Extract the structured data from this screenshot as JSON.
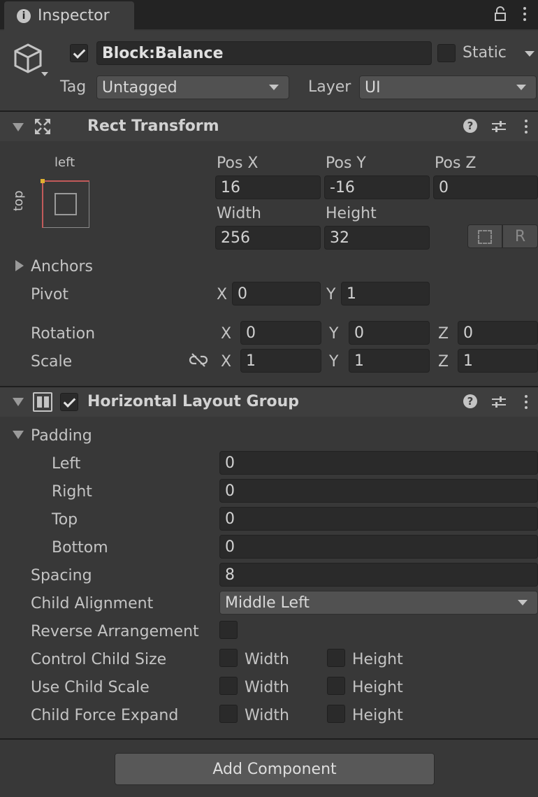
{
  "tab": {
    "title": "Inspector"
  },
  "object": {
    "name": "Block:Balance",
    "active": true,
    "static_label": "Static",
    "static_checked": false,
    "tag_label": "Tag",
    "tag_value": "Untagged",
    "layer_label": "Layer",
    "layer_value": "UI"
  },
  "rect_transform": {
    "title": "Rect Transform",
    "anchor_preset": {
      "horizontal": "left",
      "vertical": "top"
    },
    "pos_x_label": "Pos X",
    "pos_y_label": "Pos Y",
    "pos_z_label": "Pos Z",
    "pos_x": "16",
    "pos_y": "-16",
    "pos_z": "0",
    "width_label": "Width",
    "height_label": "Height",
    "width": "256",
    "height": "32",
    "raw_button": "R",
    "anchors_label": "Anchors",
    "pivot_label": "Pivot",
    "pivot": {
      "x_label": "X",
      "x": "0",
      "y_label": "Y",
      "y": "1"
    },
    "rotation_label": "Rotation",
    "rotation": {
      "x_label": "X",
      "x": "0",
      "y_label": "Y",
      "y": "0",
      "z_label": "Z",
      "z": "0"
    },
    "scale_label": "Scale",
    "scale": {
      "x_label": "X",
      "x": "1",
      "y_label": "Y",
      "y": "1",
      "z_label": "Z",
      "z": "1"
    }
  },
  "layout_group": {
    "title": "Horizontal Layout Group",
    "enabled": true,
    "padding_label": "Padding",
    "padding": [
      {
        "label": "Left",
        "value": "0"
      },
      {
        "label": "Right",
        "value": "0"
      },
      {
        "label": "Top",
        "value": "0"
      },
      {
        "label": "Bottom",
        "value": "0"
      }
    ],
    "spacing_label": "Spacing",
    "spacing": "8",
    "child_alignment_label": "Child Alignment",
    "child_alignment": "Middle Left",
    "reverse_label": "Reverse Arrangement",
    "reverse_checked": false,
    "toggle_rows": [
      {
        "label": "Control Child Size",
        "width_label": "Width",
        "height_label": "Height",
        "width_checked": false,
        "height_checked": false
      },
      {
        "label": "Use Child Scale",
        "width_label": "Width",
        "height_label": "Height",
        "width_checked": false,
        "height_checked": false
      },
      {
        "label": "Child Force Expand",
        "width_label": "Width",
        "height_label": "Height",
        "width_checked": false,
        "height_checked": false
      }
    ]
  },
  "add_component": {
    "label": "Add Component"
  },
  "icons": [
    "info-icon",
    "lock-icon",
    "kebab-menu-icon",
    "cube-icon",
    "move-icon",
    "help-icon",
    "preset-sliders-icon",
    "layout-group-icon",
    "unlink-icon",
    "blueprint-mode-icon"
  ]
}
